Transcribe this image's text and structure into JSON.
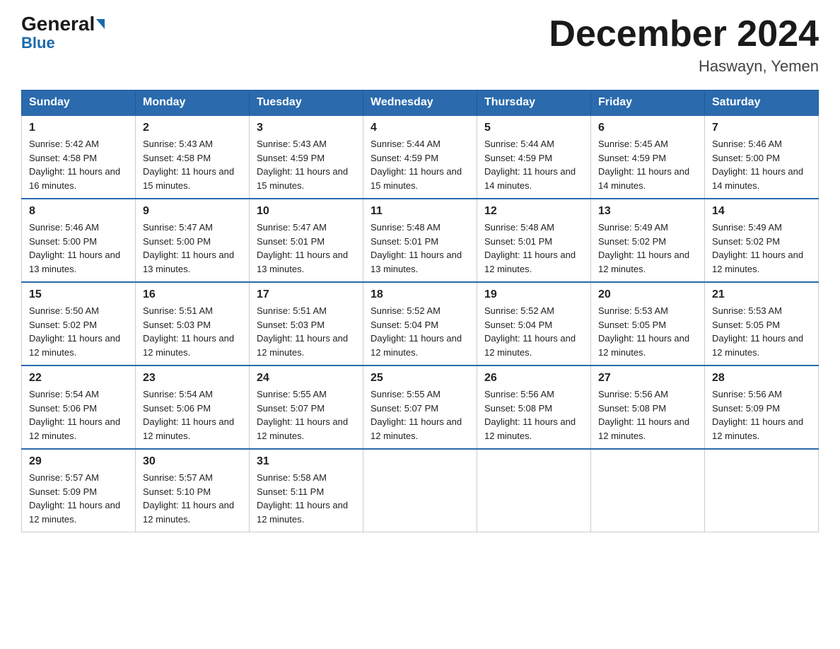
{
  "logo": {
    "text_general": "General",
    "text_blue": "Blue"
  },
  "title": "December 2024",
  "location": "Haswayn, Yemen",
  "days_of_week": [
    "Sunday",
    "Monday",
    "Tuesday",
    "Wednesday",
    "Thursday",
    "Friday",
    "Saturday"
  ],
  "weeks": [
    [
      {
        "day": "1",
        "sunrise": "5:42 AM",
        "sunset": "4:58 PM",
        "daylight": "11 hours and 16 minutes."
      },
      {
        "day": "2",
        "sunrise": "5:43 AM",
        "sunset": "4:58 PM",
        "daylight": "11 hours and 15 minutes."
      },
      {
        "day": "3",
        "sunrise": "5:43 AM",
        "sunset": "4:59 PM",
        "daylight": "11 hours and 15 minutes."
      },
      {
        "day": "4",
        "sunrise": "5:44 AM",
        "sunset": "4:59 PM",
        "daylight": "11 hours and 15 minutes."
      },
      {
        "day": "5",
        "sunrise": "5:44 AM",
        "sunset": "4:59 PM",
        "daylight": "11 hours and 14 minutes."
      },
      {
        "day": "6",
        "sunrise": "5:45 AM",
        "sunset": "4:59 PM",
        "daylight": "11 hours and 14 minutes."
      },
      {
        "day": "7",
        "sunrise": "5:46 AM",
        "sunset": "5:00 PM",
        "daylight": "11 hours and 14 minutes."
      }
    ],
    [
      {
        "day": "8",
        "sunrise": "5:46 AM",
        "sunset": "5:00 PM",
        "daylight": "11 hours and 13 minutes."
      },
      {
        "day": "9",
        "sunrise": "5:47 AM",
        "sunset": "5:00 PM",
        "daylight": "11 hours and 13 minutes."
      },
      {
        "day": "10",
        "sunrise": "5:47 AM",
        "sunset": "5:01 PM",
        "daylight": "11 hours and 13 minutes."
      },
      {
        "day": "11",
        "sunrise": "5:48 AM",
        "sunset": "5:01 PM",
        "daylight": "11 hours and 13 minutes."
      },
      {
        "day": "12",
        "sunrise": "5:48 AM",
        "sunset": "5:01 PM",
        "daylight": "11 hours and 12 minutes."
      },
      {
        "day": "13",
        "sunrise": "5:49 AM",
        "sunset": "5:02 PM",
        "daylight": "11 hours and 12 minutes."
      },
      {
        "day": "14",
        "sunrise": "5:49 AM",
        "sunset": "5:02 PM",
        "daylight": "11 hours and 12 minutes."
      }
    ],
    [
      {
        "day": "15",
        "sunrise": "5:50 AM",
        "sunset": "5:02 PM",
        "daylight": "11 hours and 12 minutes."
      },
      {
        "day": "16",
        "sunrise": "5:51 AM",
        "sunset": "5:03 PM",
        "daylight": "11 hours and 12 minutes."
      },
      {
        "day": "17",
        "sunrise": "5:51 AM",
        "sunset": "5:03 PM",
        "daylight": "11 hours and 12 minutes."
      },
      {
        "day": "18",
        "sunrise": "5:52 AM",
        "sunset": "5:04 PM",
        "daylight": "11 hours and 12 minutes."
      },
      {
        "day": "19",
        "sunrise": "5:52 AM",
        "sunset": "5:04 PM",
        "daylight": "11 hours and 12 minutes."
      },
      {
        "day": "20",
        "sunrise": "5:53 AM",
        "sunset": "5:05 PM",
        "daylight": "11 hours and 12 minutes."
      },
      {
        "day": "21",
        "sunrise": "5:53 AM",
        "sunset": "5:05 PM",
        "daylight": "11 hours and 12 minutes."
      }
    ],
    [
      {
        "day": "22",
        "sunrise": "5:54 AM",
        "sunset": "5:06 PM",
        "daylight": "11 hours and 12 minutes."
      },
      {
        "day": "23",
        "sunrise": "5:54 AM",
        "sunset": "5:06 PM",
        "daylight": "11 hours and 12 minutes."
      },
      {
        "day": "24",
        "sunrise": "5:55 AM",
        "sunset": "5:07 PM",
        "daylight": "11 hours and 12 minutes."
      },
      {
        "day": "25",
        "sunrise": "5:55 AM",
        "sunset": "5:07 PM",
        "daylight": "11 hours and 12 minutes."
      },
      {
        "day": "26",
        "sunrise": "5:56 AM",
        "sunset": "5:08 PM",
        "daylight": "11 hours and 12 minutes."
      },
      {
        "day": "27",
        "sunrise": "5:56 AM",
        "sunset": "5:08 PM",
        "daylight": "11 hours and 12 minutes."
      },
      {
        "day": "28",
        "sunrise": "5:56 AM",
        "sunset": "5:09 PM",
        "daylight": "11 hours and 12 minutes."
      }
    ],
    [
      {
        "day": "29",
        "sunrise": "5:57 AM",
        "sunset": "5:09 PM",
        "daylight": "11 hours and 12 minutes."
      },
      {
        "day": "30",
        "sunrise": "5:57 AM",
        "sunset": "5:10 PM",
        "daylight": "11 hours and 12 minutes."
      },
      {
        "day": "31",
        "sunrise": "5:58 AM",
        "sunset": "5:11 PM",
        "daylight": "11 hours and 12 minutes."
      },
      null,
      null,
      null,
      null
    ]
  ]
}
